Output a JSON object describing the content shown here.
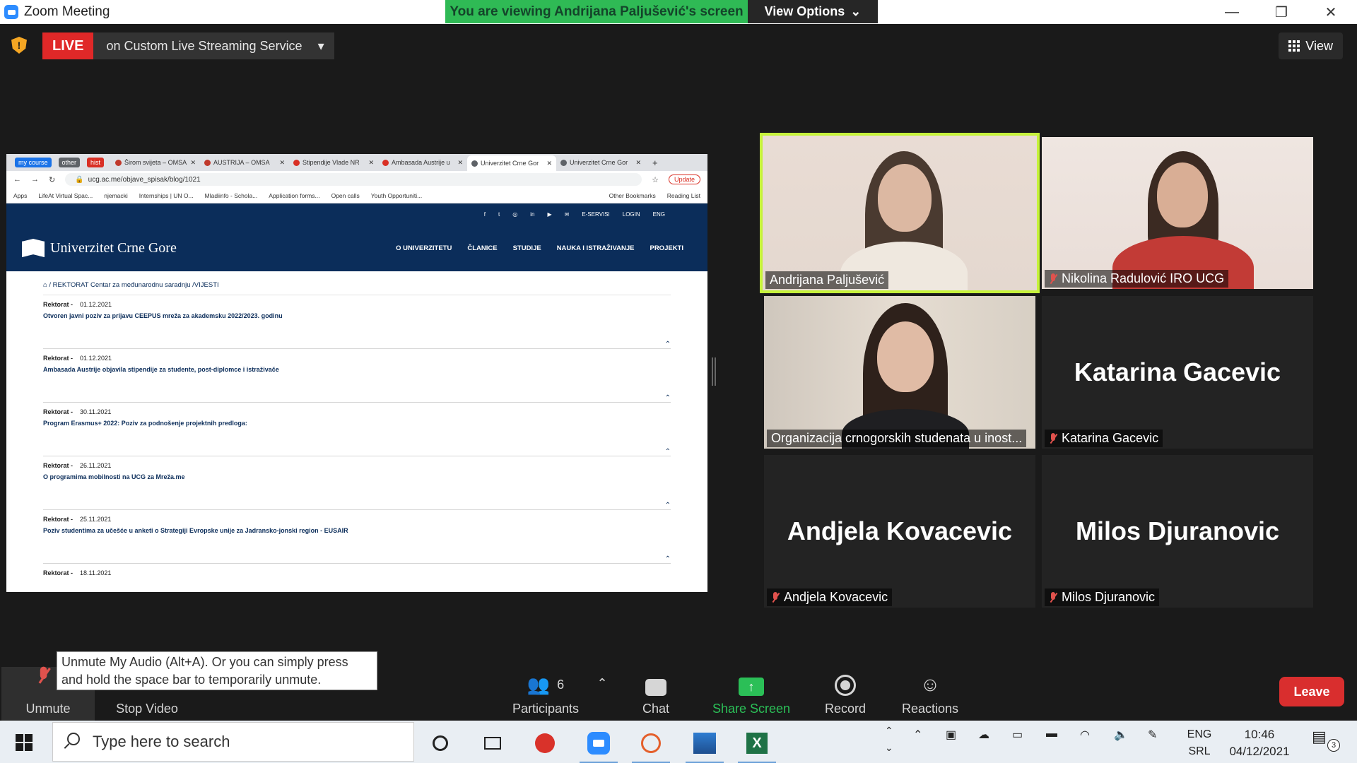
{
  "window": {
    "title": "Zoom Meeting",
    "viewing_banner": "You are viewing Andrijana Paljušević's screen",
    "view_options_label": "View Options",
    "minimize_glyph": "—",
    "restore_glyph": "❐",
    "close_glyph": "✕"
  },
  "livebar": {
    "live_label": "LIVE",
    "service_label": "on Custom Live Streaming Service",
    "view_label": "View"
  },
  "shared_screen": {
    "browser": {
      "chips": [
        {
          "label": "my course",
          "color": "#1a73e8"
        },
        {
          "label": "other",
          "color": "#5f6368"
        },
        {
          "label": "hist",
          "color": "#d93025"
        }
      ],
      "tabs": [
        {
          "title": "Širom svijeta – OMSA",
          "icon_color": "#c0392b",
          "active": false
        },
        {
          "title": "AUSTRIJA – OMSA",
          "icon_color": "#c0392b",
          "active": false
        },
        {
          "title": "Stipendije Vlade NR",
          "icon_color": "#d93025",
          "active": false
        },
        {
          "title": "Ambasada Austrije u",
          "icon_color": "#d93025",
          "active": false
        },
        {
          "title": "Univerzitet Crne Gor",
          "icon_color": "#5f6368",
          "active": true
        },
        {
          "title": "Univerzitet Crne Gor",
          "icon_color": "#5f6368",
          "active": false
        }
      ],
      "url": "ucg.ac.me/objave_spisak/blog/1021",
      "update_label": "Update",
      "bookmarks": [
        "Apps",
        "LifeAt Virtual Spac...",
        "njemacki",
        "Internships | UN O...",
        "Mladiinfo - Schola...",
        "Application forms...",
        "Open calls",
        "Youth Opportuniti..."
      ],
      "other_bookmarks": "Other Bookmarks",
      "reading_list": "Reading List"
    },
    "site": {
      "top_links": [
        "f",
        "t",
        "◎",
        "in",
        "▶",
        "✉",
        "E-SERVISI",
        "LOGIN",
        "ENG"
      ],
      "logo_text": "Univerzitet Crne Gore",
      "menu": [
        "O UNIVERZITETU",
        "ČLANICE",
        "STUDIJE",
        "NAUKA I ISTRAŽIVANJE",
        "PROJEKTI"
      ],
      "breadcrumb": "/ REKTORAT Centar za međunarodnu saradnju /VIJESTI",
      "news": [
        {
          "source": "Rektorat -",
          "date": "01.12.2021",
          "title": "Otvoren javni poziv za prijavu CEEPUS mreža za akademsku 2022/2023. godinu"
        },
        {
          "source": "Rektorat -",
          "date": "01.12.2021",
          "title": "Ambasada Austrije objavila stipendije za studente, post-diplomce i istraživače"
        },
        {
          "source": "Rektorat -",
          "date": "30.11.2021",
          "title": "Program Erasmus+ 2022: Poziv za podnošenje projektnih predloga:"
        },
        {
          "source": "Rektorat -",
          "date": "26.11.2021",
          "title": "O programima mobilnosti na UCG za Mreža.me"
        },
        {
          "source": "Rektorat -",
          "date": "25.11.2021",
          "title": "Poziv studentima za učešće u anketi o Strategiji Evropske unije za Jadransko-jonski region - EUSAIR"
        },
        {
          "source": "Rektorat -",
          "date": "18.11.2021",
          "title": ""
        }
      ]
    }
  },
  "participants": [
    {
      "name": "Andrijana Paljušević",
      "muted": false,
      "video": true,
      "speaking": true
    },
    {
      "name": "Nikolina Radulović IRO UCG",
      "muted": true,
      "video": true,
      "speaking": false
    },
    {
      "name": "Organizacija crnogorskih studenata u inost...",
      "muted": false,
      "video": true,
      "speaking": false
    },
    {
      "name": "Katarina Gacevic",
      "muted": true,
      "video": false,
      "speaking": false
    },
    {
      "name": "Andjela Kovacevic",
      "muted": true,
      "video": false,
      "speaking": false
    },
    {
      "name": "Milos Djuranovic",
      "muted": true,
      "video": false,
      "speaking": false
    }
  ],
  "toolbar": {
    "unmute_label": "Unmute",
    "stop_video_label": "Stop Video",
    "participants_label": "Participants",
    "participants_count": "6",
    "chat_label": "Chat",
    "share_label": "Share Screen",
    "record_label": "Record",
    "reactions_label": "Reactions",
    "leave_label": "Leave",
    "tooltip": "Unmute My Audio (Alt+A). Or you can simply press and hold the space bar to temporarily unmute."
  },
  "taskbar": {
    "search_placeholder": "Type here to search",
    "lang_top": "ENG",
    "lang_bottom": "SRL",
    "time": "10:46",
    "date": "04/12/2021",
    "notifications": "3"
  }
}
